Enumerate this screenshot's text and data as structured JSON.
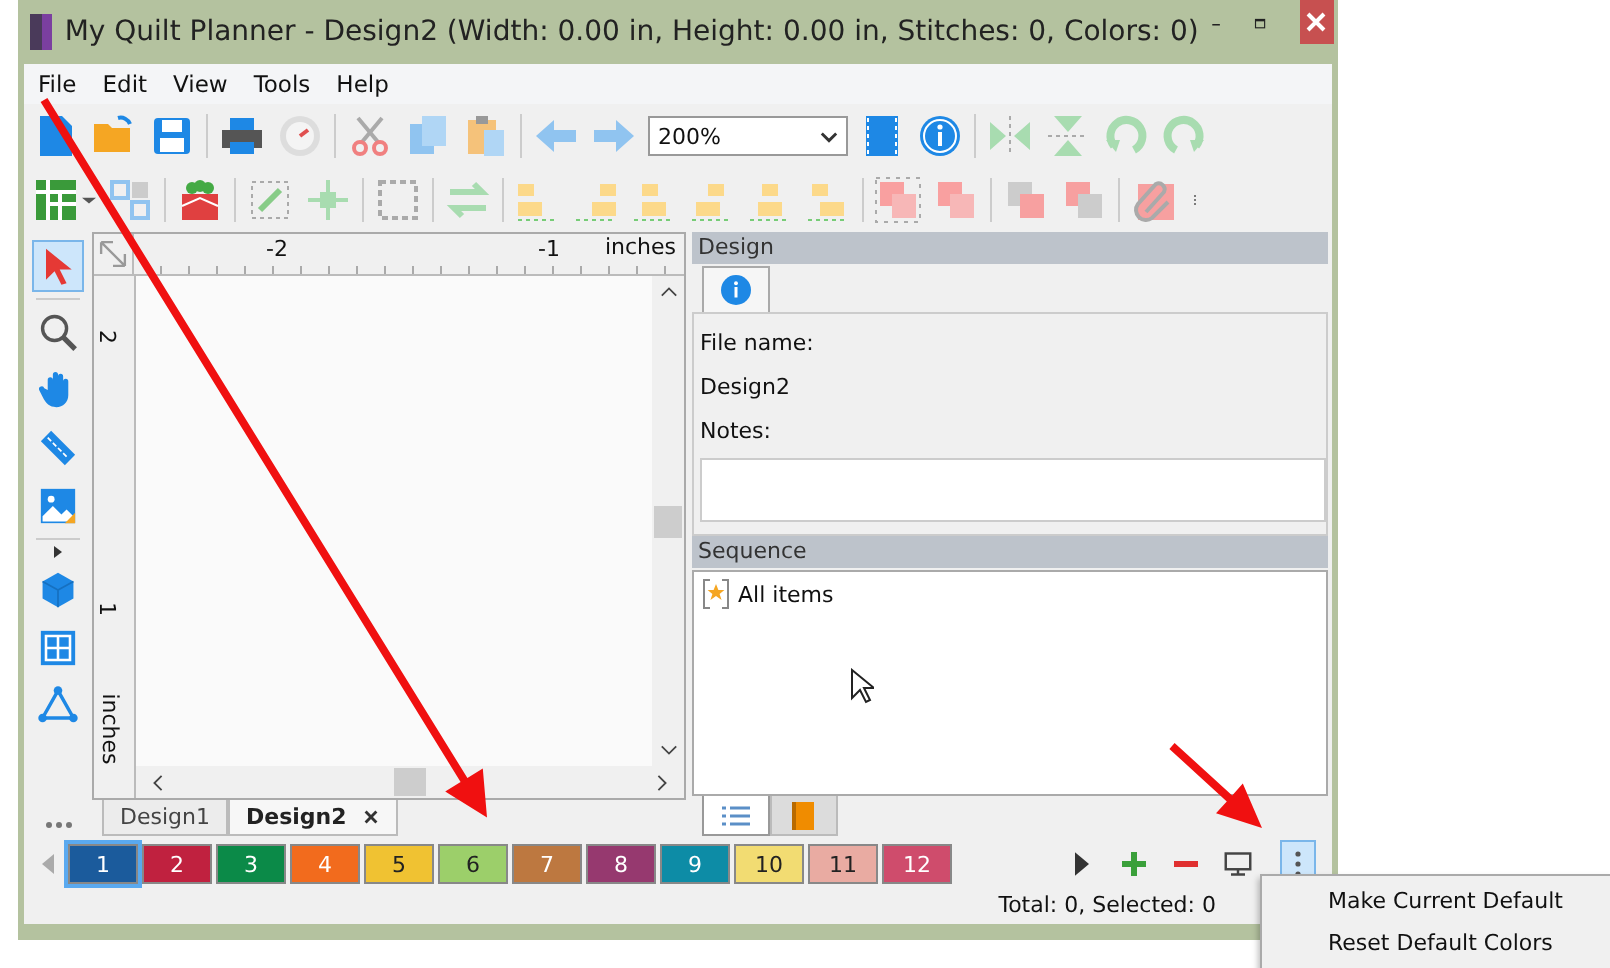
{
  "window": {
    "title": "My Quilt Planner - Design2 (Width: 0.00 in, Height: 0.00 in, Stitches: 0, Colors: 0)"
  },
  "menu": [
    "File",
    "Edit",
    "View",
    "Tools",
    "Help"
  ],
  "zoom": {
    "value": "200%"
  },
  "tools": [
    {
      "selected": true
    },
    {
      "selected": false
    },
    {
      "selected": false
    },
    {
      "selected": false
    },
    {
      "selected": false
    },
    {
      "selected": false
    },
    {
      "selected": false
    },
    {
      "selected": false
    }
  ],
  "ruler": {
    "top_ticks": [
      "-2",
      "-1"
    ],
    "top_unit": "inches",
    "left_ticks": [
      "2",
      "1"
    ],
    "left_unit": "inches"
  },
  "document_tabs": [
    {
      "label": "Design1",
      "selected": false
    },
    {
      "label": "Design2",
      "selected": true,
      "closable": true
    }
  ],
  "design_panel": {
    "title": "Design",
    "file_name_label": "File name:",
    "file_name": "Design2",
    "notes_label": "Notes:"
  },
  "sequence_panel": {
    "title": "Sequence",
    "items": [
      {
        "label": "All items"
      }
    ]
  },
  "panel_tabs": [
    {
      "selected": true
    },
    {
      "selected": false
    }
  ],
  "colors": [
    {
      "label": "1",
      "color": "#1b5b9c",
      "selected": true
    },
    {
      "label": "2",
      "color": "#c0213f",
      "selected": false
    },
    {
      "label": "3",
      "color": "#0b8a48",
      "selected": false
    },
    {
      "label": "4",
      "color": "#f26b1d",
      "selected": false
    },
    {
      "label": "5",
      "color": "#f0c232",
      "selected": false
    },
    {
      "label": "6",
      "color": "#9ccf6a",
      "selected": false
    },
    {
      "label": "7",
      "color": "#bd7840",
      "selected": false
    },
    {
      "label": "8",
      "color": "#96396f",
      "selected": false
    },
    {
      "label": "9",
      "color": "#0d8ca6",
      "selected": false
    },
    {
      "label": "10",
      "color": "#f2dc72",
      "selected": false
    },
    {
      "label": "11",
      "color": "#e9aba2",
      "selected": false
    },
    {
      "label": "12",
      "color": "#cf4c6c",
      "selected": false
    }
  ],
  "more_button": {
    "pressed": true
  },
  "status": "Total: 0, Selected: 0",
  "context_menu": {
    "items": [
      "Make Current Default",
      "Reset Default Colors"
    ]
  }
}
